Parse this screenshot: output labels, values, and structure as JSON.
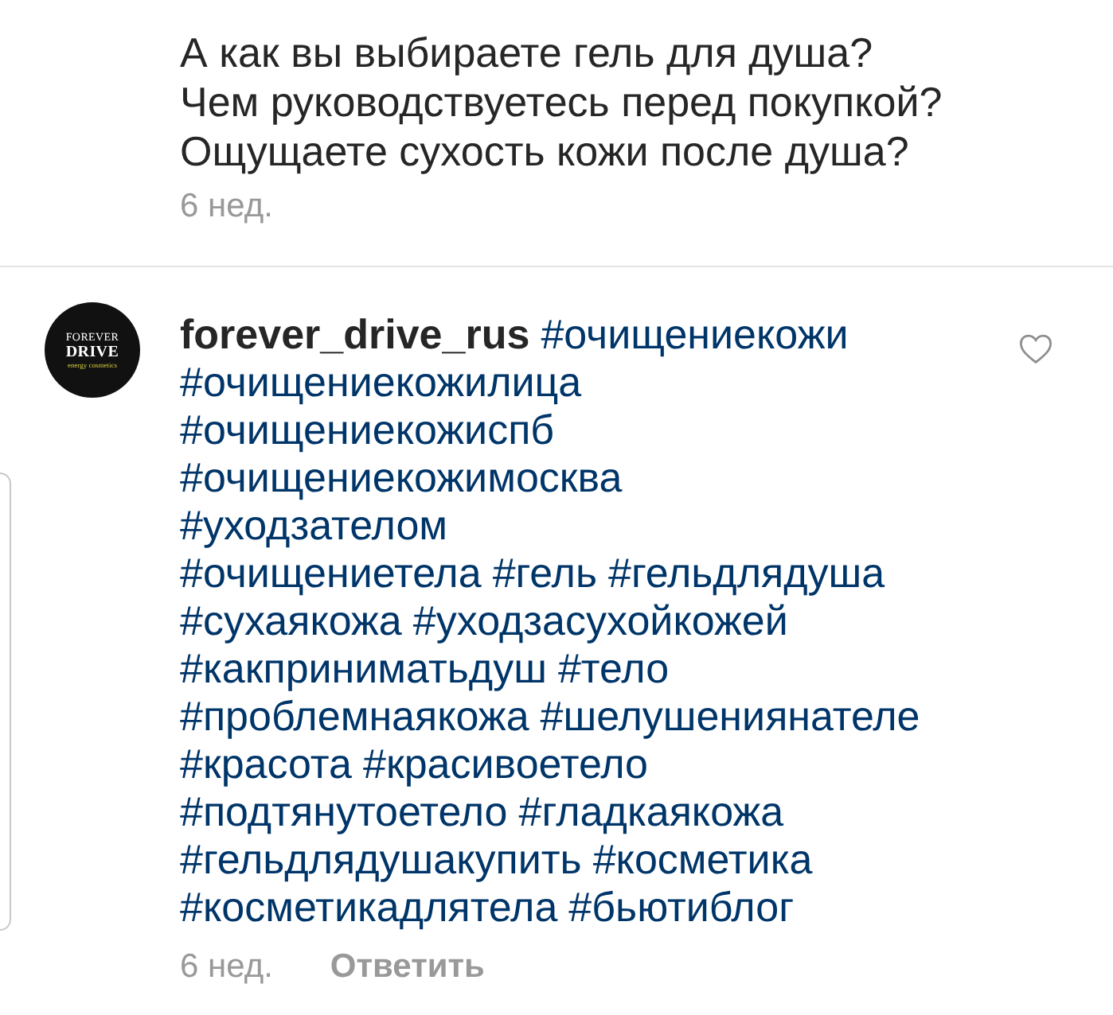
{
  "previous_comment": {
    "text_lines": [
      "А как вы выбираете гель для душа?",
      "Чем руководствуетесь перед покупкой?",
      "Ощущаете сухость кожи после душа?"
    ],
    "time": "6 нед."
  },
  "comment": {
    "avatar": {
      "logo_lines": [
        "FOREVER",
        "DRIVE",
        "energy cosmetics"
      ]
    },
    "lines": [
      [
        {
          "kind": "username",
          "text": "forever_drive_rus"
        },
        {
          "kind": "hashtag",
          "text": "#очищениекожи"
        }
      ],
      [
        {
          "kind": "hashtag",
          "text": "#очищениекожилица"
        }
      ],
      [
        {
          "kind": "hashtag",
          "text": "#очищениекожиспб"
        }
      ],
      [
        {
          "kind": "hashtag",
          "text": "#очищениекожимосква"
        }
      ],
      [
        {
          "kind": "hashtag",
          "text": "#уходзателом"
        }
      ],
      [
        {
          "kind": "hashtag",
          "text": "#очищениетела"
        },
        {
          "kind": "hashtag",
          "text": "#гель"
        },
        {
          "kind": "hashtag",
          "text": "#гельдлядуша"
        }
      ],
      [
        {
          "kind": "hashtag",
          "text": "#сухаякожа"
        },
        {
          "kind": "hashtag",
          "text": "#уходзасухойкожей"
        }
      ],
      [
        {
          "kind": "hashtag",
          "text": "#какприниматьдуш"
        },
        {
          "kind": "hashtag",
          "text": "#тело"
        }
      ],
      [
        {
          "kind": "hashtag",
          "text": "#проблемнаякожа"
        },
        {
          "kind": "hashtag",
          "text": "#шелушениянателе"
        }
      ],
      [
        {
          "kind": "hashtag",
          "text": "#красота"
        },
        {
          "kind": "hashtag",
          "text": "#красивоетело"
        }
      ],
      [
        {
          "kind": "hashtag",
          "text": "#подтянутоетело"
        },
        {
          "kind": "hashtag",
          "text": "#гладкаякожа"
        }
      ],
      [
        {
          "kind": "hashtag",
          "text": "#гельдлядушакупить"
        },
        {
          "kind": "hashtag",
          "text": "#косметика"
        }
      ],
      [
        {
          "kind": "hashtag",
          "text": "#косметикадлятела"
        },
        {
          "kind": "hashtag",
          "text": "#бьютиблог"
        }
      ]
    ],
    "liked": false,
    "time": "6 нед.",
    "reply_label": "Ответить"
  }
}
